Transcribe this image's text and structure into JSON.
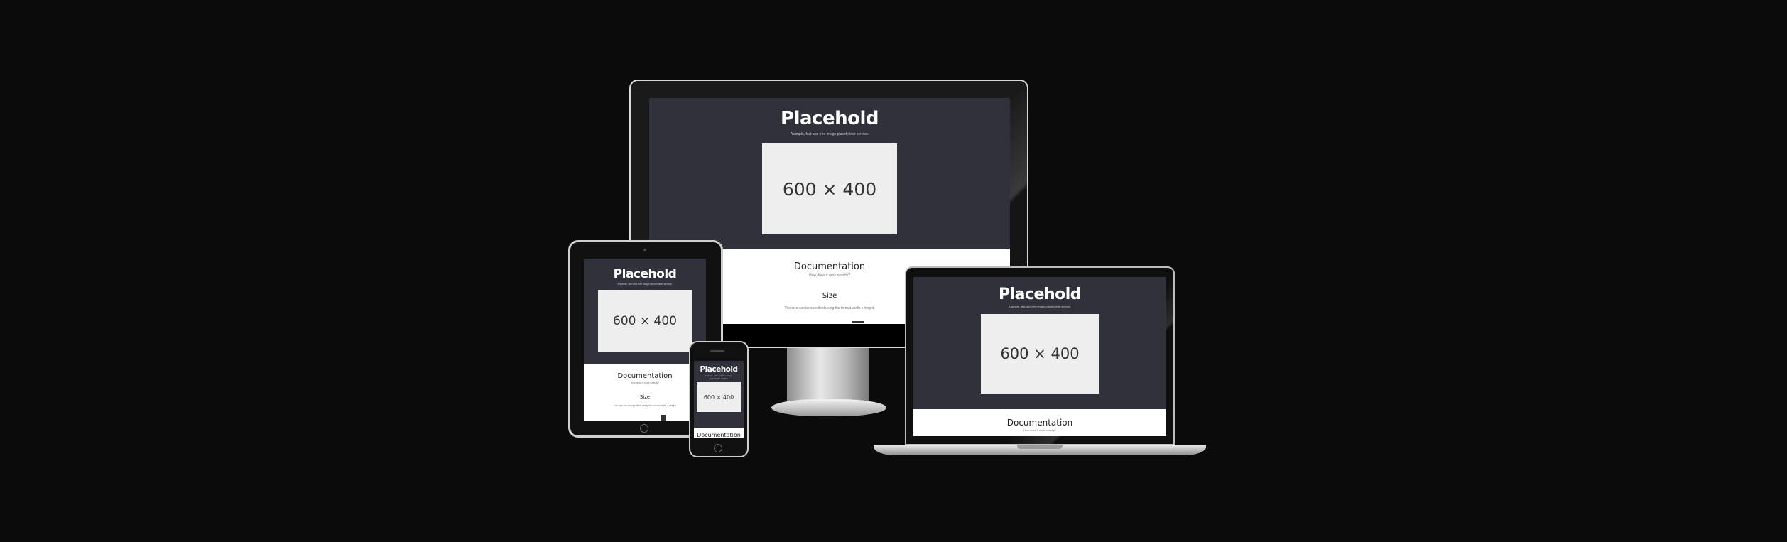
{
  "devices": {
    "desktop": {
      "brand": "Placehold",
      "tagline": "A simple, fast and free image placeholder service.",
      "image_label": "600 × 400",
      "section_title": "Documentation",
      "section_sub": "How does it work exactly?",
      "size_title": "Size",
      "size_text": "The size can be specified using the format width x height."
    },
    "tablet": {
      "brand": "Placehold",
      "tagline": "A simple, fast and free image placeholder service.",
      "image_label": "600 × 400",
      "section_title": "Documentation",
      "section_sub": "How does it work exactly?",
      "size_title": "Size",
      "size_text": "The size can be specified using the format width x height."
    },
    "phone": {
      "brand": "Placehold",
      "tagline": "A simple, fast and free image placeholder service.",
      "image_label": "600 × 400",
      "section_title": "Documentation"
    },
    "laptop": {
      "brand": "Placehold",
      "tagline": "A simple, fast and free image placeholder service.",
      "image_label": "600 × 400",
      "section_title": "Documentation",
      "section_sub": "How does it work exactly?"
    }
  }
}
